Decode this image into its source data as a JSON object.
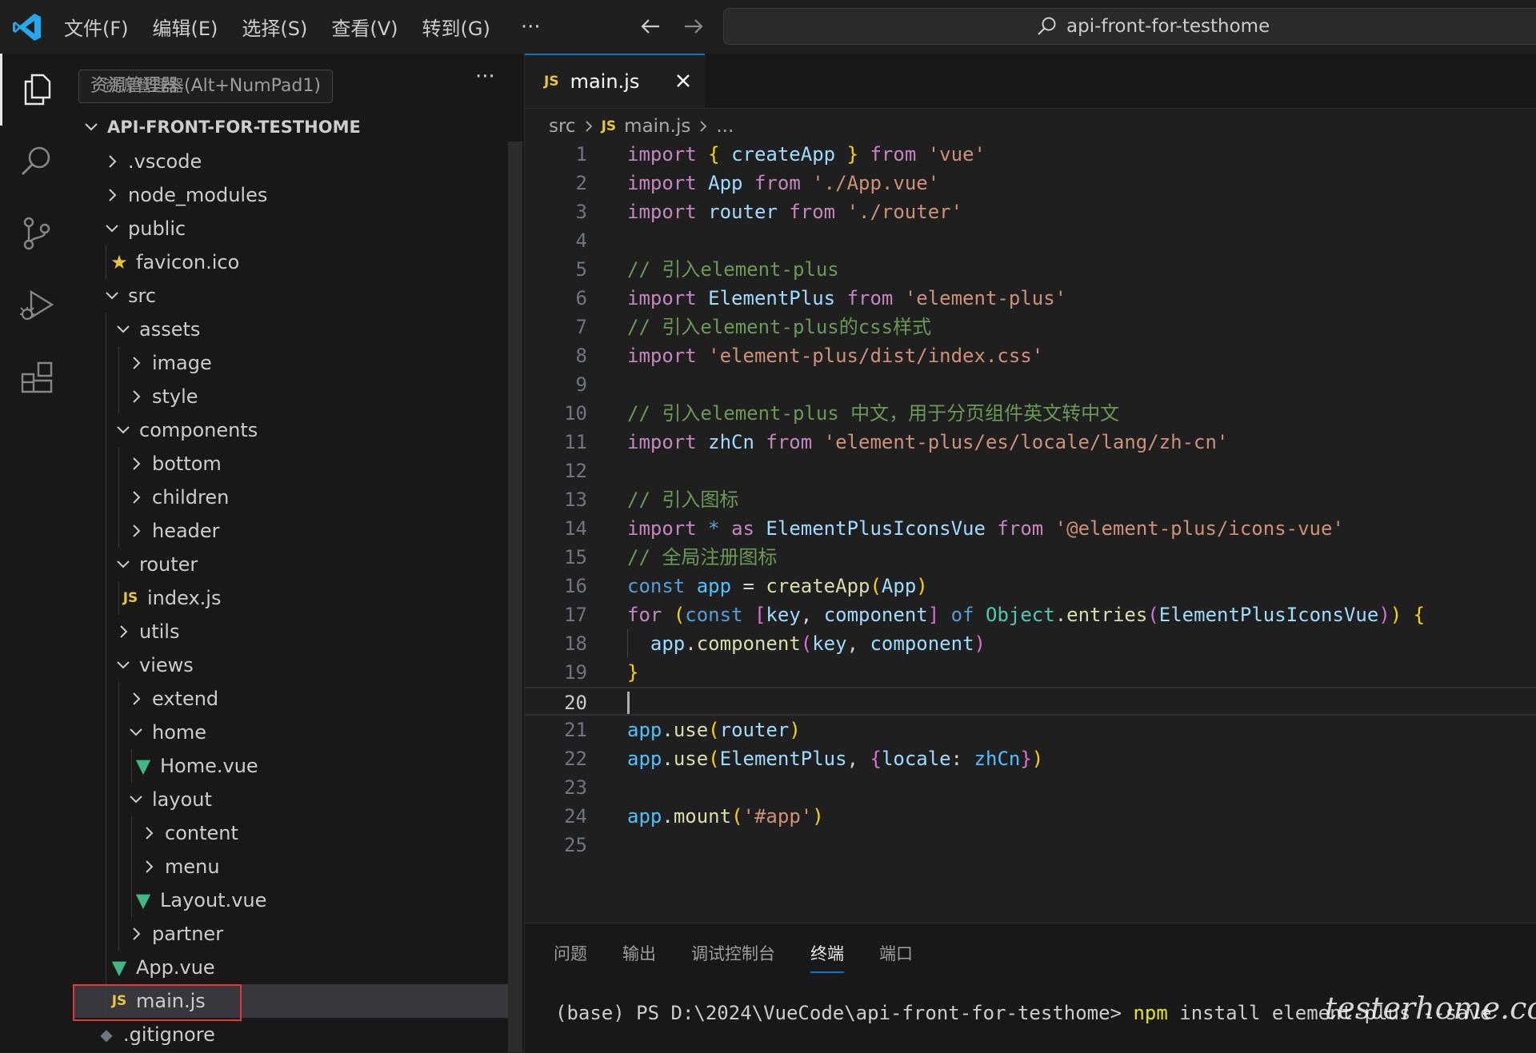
{
  "menu": {
    "items": [
      "文件(F)",
      "编辑(E)",
      "选择(S)",
      "查看(V)",
      "转到(G)"
    ],
    "more": "···"
  },
  "search": {
    "text": "api-front-for-testhome"
  },
  "sidebar": {
    "title": "资源管理器",
    "tooltip": "资源管理器 (Alt+NumPad1)",
    "more": "···",
    "root": "API-FRONT-FOR-TESTHOME",
    "tree": [
      ".vscode",
      "node_modules",
      "public",
      "favicon.ico",
      "src",
      "assets",
      "image",
      "style",
      "components",
      "bottom",
      "children",
      "header",
      "router",
      "index.js",
      "utils",
      "views",
      "extend",
      "home",
      "Home.vue",
      "layout",
      "content",
      "menu",
      "Layout.vue",
      "partner",
      "App.vue",
      "main.js",
      ".gitignore"
    ]
  },
  "icons": {
    "js": "JS"
  },
  "tab": {
    "label": "main.js"
  },
  "breadcrumb": {
    "folder": "src",
    "file": "main.js",
    "ellipsis": "..."
  },
  "editor": {
    "current_line": 20,
    "lines": [
      "import { createApp } from 'vue'",
      "import App from './App.vue'",
      "import router from './router'",
      "",
      "// 引入element-plus",
      "import ElementPlus from 'element-plus'",
      "// 引入element-plus的css样式",
      "import 'element-plus/dist/index.css'",
      "",
      "// 引入element-plus 中文，用于分页组件英文转中文",
      "import zhCn from 'element-plus/es/locale/lang/zh-cn'",
      "",
      "// 引入图标",
      "import * as ElementPlusIconsVue from '@element-plus/icons-vue'",
      "// 全局注册图标",
      "const app = createApp(App)",
      "for (const [key, component] of Object.entries(ElementPlusIconsVue)) {",
      "  app.component(key, component)",
      "}",
      "",
      "app.use(router)",
      "app.use(ElementPlus, {locale: zhCn})",
      "",
      "app.mount('#app')",
      ""
    ]
  },
  "panel": {
    "tabs": [
      "问题",
      "输出",
      "调试控制台",
      "终端",
      "端口"
    ],
    "active_tab": "终端"
  },
  "terminal": {
    "prompt": "(base) PS D:\\2024\\VueCode\\api-front-for-testhome> ",
    "command": "npm",
    "args": " install element-plus --save"
  },
  "watermark": "testerhome.com"
}
